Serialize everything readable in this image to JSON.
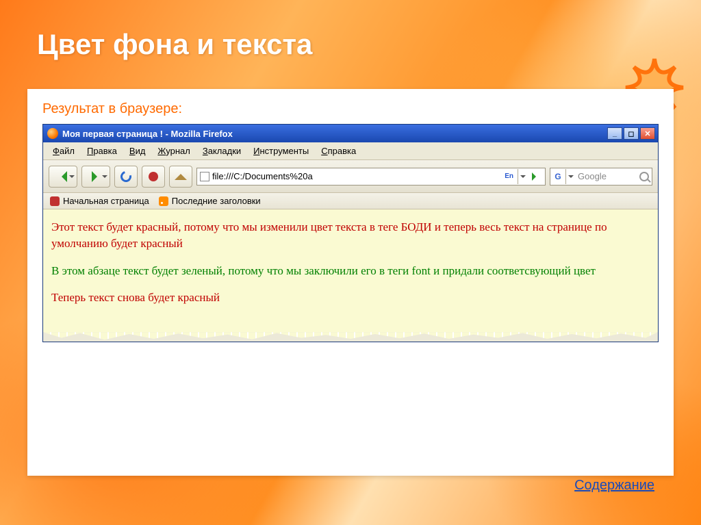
{
  "slide": {
    "title": "Цвет фона и текста",
    "result_label": "Результат в браузере:",
    "contents_link": "Содержание"
  },
  "firefox": {
    "title": "Моя первая страница ! - Mozilla Firefox",
    "menu": {
      "file": "Файл",
      "edit": "Правка",
      "view": "Вид",
      "history": "Журнал",
      "bookmarks": "Закладки",
      "tools": "Инструменты",
      "help": "Справка"
    },
    "url": "file:///C:/Documents%20a",
    "lang_indicator": "En",
    "search_engine": "G",
    "search_placeholder": "Google",
    "bookmarks_bar": {
      "home_page": "Начальная страница",
      "latest_headlines": "Последние заголовки"
    },
    "page": {
      "p1": "Этот текст будет красный, потому что мы изменили цвет текста в теге БОДИ и теперь весь текст на странице по умолчанию будет красный",
      "p2": "В этом абзаце текст будет зеленый, потому что мы заключили его в теги font и придали соответсвующий цвет",
      "p3": "Теперь текст снова будет красный"
    }
  }
}
